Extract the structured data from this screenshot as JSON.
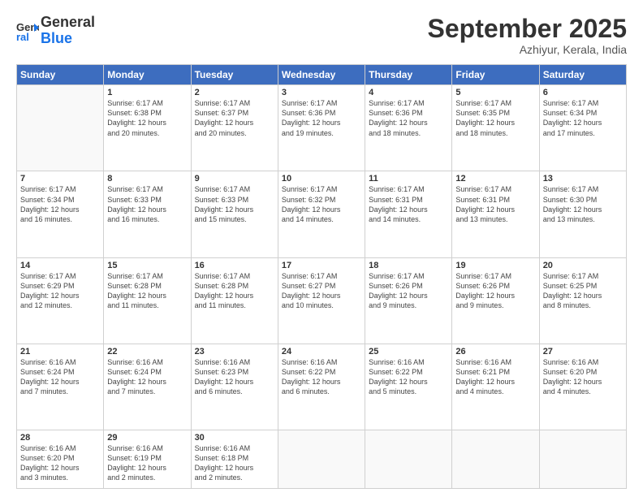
{
  "header": {
    "logo_line1": "General",
    "logo_line2": "Blue",
    "month": "September 2025",
    "location": "Azhiyur, Kerala, India"
  },
  "weekdays": [
    "Sunday",
    "Monday",
    "Tuesday",
    "Wednesday",
    "Thursday",
    "Friday",
    "Saturday"
  ],
  "weeks": [
    [
      {
        "day": "",
        "info": ""
      },
      {
        "day": "1",
        "info": "Sunrise: 6:17 AM\nSunset: 6:38 PM\nDaylight: 12 hours\nand 20 minutes."
      },
      {
        "day": "2",
        "info": "Sunrise: 6:17 AM\nSunset: 6:37 PM\nDaylight: 12 hours\nand 20 minutes."
      },
      {
        "day": "3",
        "info": "Sunrise: 6:17 AM\nSunset: 6:36 PM\nDaylight: 12 hours\nand 19 minutes."
      },
      {
        "day": "4",
        "info": "Sunrise: 6:17 AM\nSunset: 6:36 PM\nDaylight: 12 hours\nand 18 minutes."
      },
      {
        "day": "5",
        "info": "Sunrise: 6:17 AM\nSunset: 6:35 PM\nDaylight: 12 hours\nand 18 minutes."
      },
      {
        "day": "6",
        "info": "Sunrise: 6:17 AM\nSunset: 6:34 PM\nDaylight: 12 hours\nand 17 minutes."
      }
    ],
    [
      {
        "day": "7",
        "info": "Sunrise: 6:17 AM\nSunset: 6:34 PM\nDaylight: 12 hours\nand 16 minutes."
      },
      {
        "day": "8",
        "info": "Sunrise: 6:17 AM\nSunset: 6:33 PM\nDaylight: 12 hours\nand 16 minutes."
      },
      {
        "day": "9",
        "info": "Sunrise: 6:17 AM\nSunset: 6:33 PM\nDaylight: 12 hours\nand 15 minutes."
      },
      {
        "day": "10",
        "info": "Sunrise: 6:17 AM\nSunset: 6:32 PM\nDaylight: 12 hours\nand 14 minutes."
      },
      {
        "day": "11",
        "info": "Sunrise: 6:17 AM\nSunset: 6:31 PM\nDaylight: 12 hours\nand 14 minutes."
      },
      {
        "day": "12",
        "info": "Sunrise: 6:17 AM\nSunset: 6:31 PM\nDaylight: 12 hours\nand 13 minutes."
      },
      {
        "day": "13",
        "info": "Sunrise: 6:17 AM\nSunset: 6:30 PM\nDaylight: 12 hours\nand 13 minutes."
      }
    ],
    [
      {
        "day": "14",
        "info": "Sunrise: 6:17 AM\nSunset: 6:29 PM\nDaylight: 12 hours\nand 12 minutes."
      },
      {
        "day": "15",
        "info": "Sunrise: 6:17 AM\nSunset: 6:28 PM\nDaylight: 12 hours\nand 11 minutes."
      },
      {
        "day": "16",
        "info": "Sunrise: 6:17 AM\nSunset: 6:28 PM\nDaylight: 12 hours\nand 11 minutes."
      },
      {
        "day": "17",
        "info": "Sunrise: 6:17 AM\nSunset: 6:27 PM\nDaylight: 12 hours\nand 10 minutes."
      },
      {
        "day": "18",
        "info": "Sunrise: 6:17 AM\nSunset: 6:26 PM\nDaylight: 12 hours\nand 9 minutes."
      },
      {
        "day": "19",
        "info": "Sunrise: 6:17 AM\nSunset: 6:26 PM\nDaylight: 12 hours\nand 9 minutes."
      },
      {
        "day": "20",
        "info": "Sunrise: 6:17 AM\nSunset: 6:25 PM\nDaylight: 12 hours\nand 8 minutes."
      }
    ],
    [
      {
        "day": "21",
        "info": "Sunrise: 6:16 AM\nSunset: 6:24 PM\nDaylight: 12 hours\nand 7 minutes."
      },
      {
        "day": "22",
        "info": "Sunrise: 6:16 AM\nSunset: 6:24 PM\nDaylight: 12 hours\nand 7 minutes."
      },
      {
        "day": "23",
        "info": "Sunrise: 6:16 AM\nSunset: 6:23 PM\nDaylight: 12 hours\nand 6 minutes."
      },
      {
        "day": "24",
        "info": "Sunrise: 6:16 AM\nSunset: 6:22 PM\nDaylight: 12 hours\nand 6 minutes."
      },
      {
        "day": "25",
        "info": "Sunrise: 6:16 AM\nSunset: 6:22 PM\nDaylight: 12 hours\nand 5 minutes."
      },
      {
        "day": "26",
        "info": "Sunrise: 6:16 AM\nSunset: 6:21 PM\nDaylight: 12 hours\nand 4 minutes."
      },
      {
        "day": "27",
        "info": "Sunrise: 6:16 AM\nSunset: 6:20 PM\nDaylight: 12 hours\nand 4 minutes."
      }
    ],
    [
      {
        "day": "28",
        "info": "Sunrise: 6:16 AM\nSunset: 6:20 PM\nDaylight: 12 hours\nand 3 minutes."
      },
      {
        "day": "29",
        "info": "Sunrise: 6:16 AM\nSunset: 6:19 PM\nDaylight: 12 hours\nand 2 minutes."
      },
      {
        "day": "30",
        "info": "Sunrise: 6:16 AM\nSunset: 6:18 PM\nDaylight: 12 hours\nand 2 minutes."
      },
      {
        "day": "",
        "info": ""
      },
      {
        "day": "",
        "info": ""
      },
      {
        "day": "",
        "info": ""
      },
      {
        "day": "",
        "info": ""
      }
    ]
  ]
}
